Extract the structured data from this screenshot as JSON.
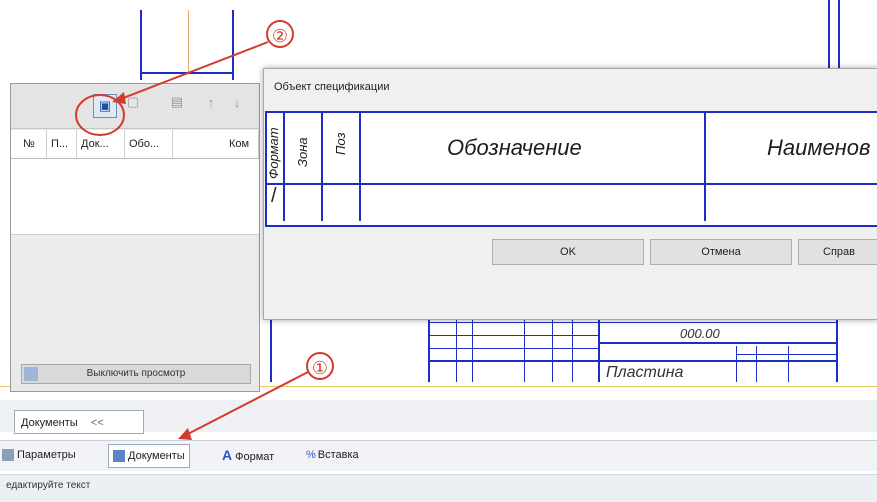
{
  "spec_dialog": {
    "title": "Объект спецификации",
    "columns": {
      "format": "Формат",
      "zone": "Зона",
      "pos": "Поз",
      "designation": "Обозначение",
      "name": "Наименов"
    },
    "row_first_cell": "/",
    "buttons": {
      "ok": "OK",
      "cancel": "Отмена",
      "help": "Справ"
    }
  },
  "doc_panel": {
    "columns": [
      "№",
      "П...",
      "Док...",
      "Обо...",
      "Ком"
    ],
    "preview_toggle": "Выключить просмотр"
  },
  "drawing": {
    "title_block_code": "000.00",
    "title_block_name": "Пластина"
  },
  "docs_tab": {
    "label": "Документы",
    "collapse": "<<"
  },
  "panel_tabs": {
    "params": "Параметры",
    "docs": "Документы",
    "format": "Формат",
    "insert": "Вставка"
  },
  "status": "едактируйте текст",
  "markers": {
    "one": "①",
    "two": "②"
  },
  "colors": {
    "drawing_line": "#1b2fc8",
    "annotation": "#d43b2e"
  }
}
